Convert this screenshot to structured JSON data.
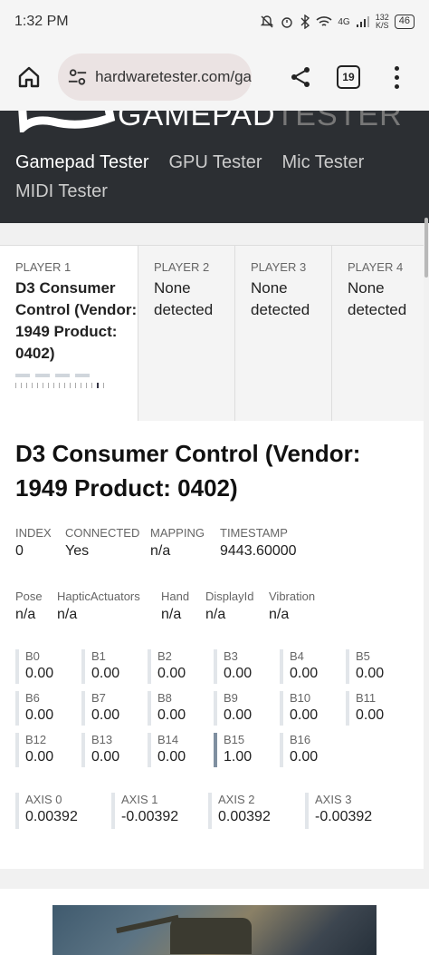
{
  "status_bar": {
    "time": "1:32 PM",
    "network": "4G",
    "speed_value": "132",
    "speed_unit": "K/S",
    "battery": "46"
  },
  "browser": {
    "url": "hardwaretester.com/ga",
    "tab_count": "19"
  },
  "site": {
    "logo_text_bright": "GAMEPAD",
    "logo_text_dim": "TESTER",
    "nav": [
      {
        "label": "Gamepad Tester"
      },
      {
        "label": "GPU Tester"
      },
      {
        "label": "Mic Tester"
      },
      {
        "label": "MIDI Tester"
      }
    ]
  },
  "players": [
    {
      "label": "PLAYER 1",
      "name": "D3 Consumer Control (Vendor: 1949 Product: 0402)"
    },
    {
      "label": "PLAYER 2",
      "name": "None detected"
    },
    {
      "label": "PLAYER 3",
      "name": "None detected"
    },
    {
      "label": "PLAYER 4",
      "name": "None detected"
    }
  ],
  "device": {
    "title": "D3 Consumer Control (Vendor: 1949 Product: 0402)",
    "info": [
      {
        "label": "INDEX",
        "value": "0"
      },
      {
        "label": "CONNECTED",
        "value": "Yes"
      },
      {
        "label": "MAPPING",
        "value": "n/a"
      },
      {
        "label": "TIMESTAMP",
        "value": "9443.60000"
      }
    ],
    "features": [
      {
        "label": "Pose",
        "value": "n/a"
      },
      {
        "label": "HapticActuators",
        "value": "n/a"
      },
      {
        "label": "Hand",
        "value": "n/a"
      },
      {
        "label": "DisplayId",
        "value": "n/a"
      },
      {
        "label": "Vibration",
        "value": "n/a"
      }
    ],
    "buttons": [
      {
        "label": "B0",
        "value": "0.00"
      },
      {
        "label": "B1",
        "value": "0.00"
      },
      {
        "label": "B2",
        "value": "0.00"
      },
      {
        "label": "B3",
        "value": "0.00"
      },
      {
        "label": "B4",
        "value": "0.00"
      },
      {
        "label": "B5",
        "value": "0.00"
      },
      {
        "label": "B6",
        "value": "0.00"
      },
      {
        "label": "B7",
        "value": "0.00"
      },
      {
        "label": "B8",
        "value": "0.00"
      },
      {
        "label": "B9",
        "value": "0.00"
      },
      {
        "label": "B10",
        "value": "0.00"
      },
      {
        "label": "B11",
        "value": "0.00"
      },
      {
        "label": "B12",
        "value": "0.00"
      },
      {
        "label": "B13",
        "value": "0.00"
      },
      {
        "label": "B14",
        "value": "0.00"
      },
      {
        "label": "B15",
        "value": "1.00"
      },
      {
        "label": "B16",
        "value": "0.00"
      }
    ],
    "axes": [
      {
        "label": "AXIS 0",
        "value": "0.00392"
      },
      {
        "label": "AXIS 1",
        "value": "-0.00392"
      },
      {
        "label": "AXIS 2",
        "value": "0.00392"
      },
      {
        "label": "AXIS 3",
        "value": "-0.00392"
      }
    ]
  },
  "colors": {
    "header_bg": "#2c2f33",
    "pressed_indicator": "#7f8fa0"
  }
}
